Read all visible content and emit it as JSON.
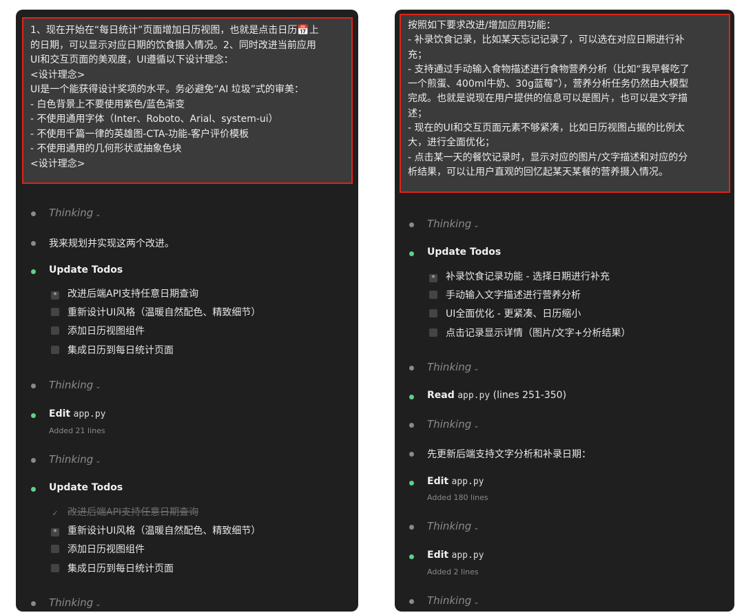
{
  "left": {
    "prompt": "1、现在开始在“每日统计”页面增加日历视图，也就是点击日历📅上\n的日期，可以显示对应日期的饮食摄入情况。2、同时改进当前应用\nUI和交互页面的美观度，UI遵循以下设计理念：\n<设计理念>\nUI是一个能获得设计奖项的水平。务必避免“AI 垃圾”式的审美：\n- 白色背景上不要使用紫色/蓝色渐变\n- 不使用通用字体（Inter、Roboto、Arial、system-ui）\n- 不使用千篇一律的英雄图-CTA-功能-客户评价模板\n- 不使用通用的几何形状或抽象色块\n<设计理念>",
    "thinking_label": "Thinking",
    "plan_text": "我来规划并实现这两个改进。",
    "update_todos_1": {
      "title": "Update Todos",
      "items": [
        {
          "mark": "*",
          "label": "改进后端API支持任意日期查询"
        },
        {
          "mark": "",
          "label": "重新设计UI风格（温暖自然配色、精致细节）"
        },
        {
          "mark": "",
          "label": "添加日历视图组件"
        },
        {
          "mark": "",
          "label": "集成日历到每日统计页面"
        }
      ]
    },
    "edit_1": {
      "action": "Edit",
      "file": "app.py",
      "detail": "Added 21 lines"
    },
    "update_todos_2": {
      "title": "Update Todos",
      "items": [
        {
          "mark": "✓",
          "label": "改进后端API支持任意日期查询"
        },
        {
          "mark": "*",
          "label": "重新设计UI风格（温暖自然配色、精致细节）"
        },
        {
          "mark": "",
          "label": "添加日历视图组件"
        },
        {
          "mark": "",
          "label": "集成日历到每日统计页面"
        }
      ]
    }
  },
  "right": {
    "prompt": "按照如下要求改进/增加应用功能：\n- 补录饮食记录，比如某天忘记记录了，可以选在对应日期进行补\n充；\n- 支持通过手动输入食物描述进行食物营养分析（比如“我早餐吃了\n一个煎蛋、400ml牛奶、30g蓝莓”），营养分析任务仍然由大模型\n完成。也就是说现在用户提供的信息可以是图片，也可以是文字描\n述；\n- 现在的UI和交互页面元素不够紧凑，比如日历视图占据的比例太\n大，进行全面优化；\n- 点击某一天的餐饮记录时，显示对应的图片/文字描述和对应的分\n析结果，可以让用户直观的回忆起某天某餐的营养摄入情况。",
    "thinking_label": "Thinking",
    "update_todos": {
      "title": "Update Todos",
      "items": [
        {
          "mark": "*",
          "label": "补录饮食记录功能 - 选择日期进行补充"
        },
        {
          "mark": "",
          "label": "手动输入文字描述进行营养分析"
        },
        {
          "mark": "",
          "label": "UI全面优化 - 更紧凑、日历缩小"
        },
        {
          "mark": "",
          "label": "点击记录显示详情（图片/文字+分析结果）"
        }
      ]
    },
    "read": {
      "action": "Read",
      "file": "app.py",
      "range": "(lines 251-350)"
    },
    "backend_text": "先更新后端支持文字分析和补录日期：",
    "edit_1": {
      "action": "Edit",
      "file": "app.py",
      "detail": "Added 180 lines"
    },
    "edit_2": {
      "action": "Edit",
      "file": "app.py",
      "detail": "Added 2 lines"
    }
  },
  "colors": {
    "panel_bg": "#1f1f1f",
    "prompt_bg": "#3b3b3b",
    "highlight_border": "#e0241b",
    "dot_active": "#5fd08a",
    "dot_idle": "#8a8a8a"
  }
}
